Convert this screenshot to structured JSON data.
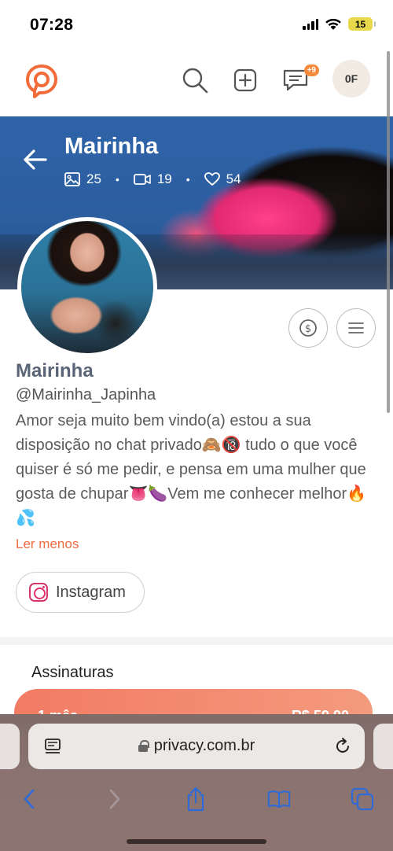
{
  "status_bar": {
    "time": "07:28",
    "battery": "15"
  },
  "header": {
    "chat_badge": "+9",
    "avatar_initials": "0F"
  },
  "cover": {
    "title": "Mairinha",
    "stats": {
      "photos": "25",
      "videos": "19",
      "likes": "54"
    }
  },
  "profile": {
    "name": "Mairinha",
    "handle": "@Mairinha_Japinha",
    "bio": "Amor seja muito bem vindo(a) estou a sua disposição no chat privado🙈🔞 tudo o que você quiser é só me pedir, e pensa em uma mulher que gosta de chupar👅🍆Vem me conhecer melhor🔥💦",
    "less_link": "Ler menos",
    "instagram_label": "Instagram"
  },
  "subscriptions": {
    "title": "Assinaturas",
    "plan_label": "1 mês",
    "plan_price": "R$ 59,90"
  },
  "browser": {
    "url": "privacy.com.br"
  },
  "colors": {
    "brand": "#f27b63",
    "link": "#ef6b40",
    "safari_accent": "#2f6ad9"
  }
}
